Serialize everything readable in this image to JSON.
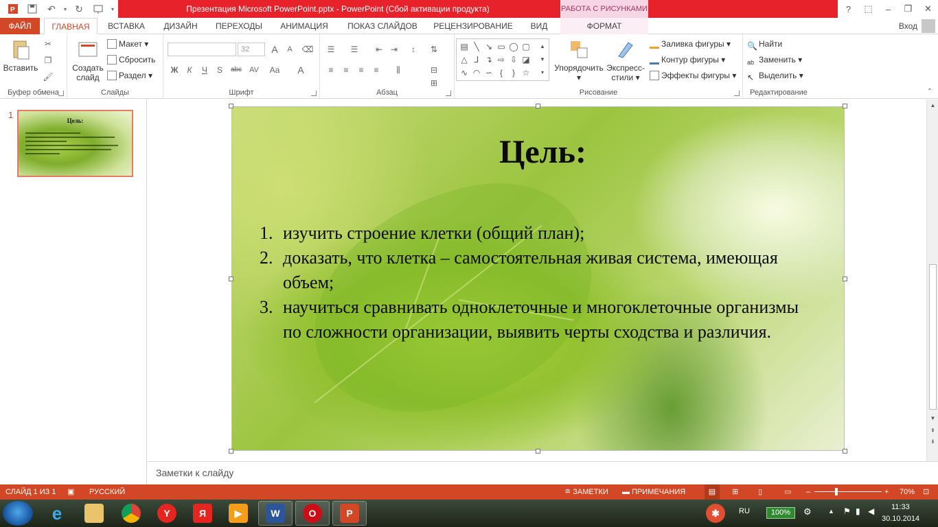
{
  "window": {
    "title": "Презентация Microsoft PowerPoint.pptx -  PowerPoint (Сбой активации продукта)",
    "context_group": "РАБОТА С РИСУНКАМИ"
  },
  "tabs": {
    "file": "ФАЙЛ",
    "home": "ГЛАВНАЯ",
    "insert": "ВСТАВКА",
    "design": "ДИЗАЙН",
    "transitions": "ПЕРЕХОДЫ",
    "animation": "АНИМАЦИЯ",
    "slideshow": "ПОКАЗ СЛАЙДОВ",
    "review": "РЕЦЕНЗИРОВАНИЕ",
    "view": "ВИД",
    "format": "ФОРМАТ",
    "login": "Вход"
  },
  "ribbon": {
    "clipboard": {
      "paste": "Вставить",
      "label": "Буфер обмена"
    },
    "slides": {
      "new_slide_line1": "Создать",
      "new_slide_line2": "слайд",
      "layout": "Макет",
      "reset": "Сбросить",
      "section": "Раздел",
      "label": "Слайды"
    },
    "font": {
      "font_size": "32",
      "bold": "Ж",
      "italic": "К",
      "underline": "Ч",
      "shadow": "S",
      "strike": "abc",
      "spacing": "AV",
      "case": "Aa",
      "color": "A",
      "grow": "A",
      "shrink": "A",
      "label": "Шрифт"
    },
    "paragraph": {
      "label": "Абзац"
    },
    "drawing": {
      "arrange": "Упорядочить",
      "quick_styles_line1": "Экспресс-",
      "quick_styles_line2": "стили",
      "fill": "Заливка фигуры",
      "outline": "Контур фигуры",
      "effects": "Эффекты фигуры",
      "label": "Рисование"
    },
    "editing": {
      "find": "Найти",
      "replace": "Заменить",
      "select": "Выделить",
      "label": "Редактирование"
    }
  },
  "thumbnails": {
    "number": "1",
    "title": "Цель:"
  },
  "slide": {
    "title": "Цель:",
    "items": [
      {
        "num": "1.",
        "text": "изучить строение клетки (общий план);"
      },
      {
        "num": "2.",
        "text": "доказать, что клетка – самостоятельная живая система, имеющая объем;"
      },
      {
        "num": "3.",
        "text": "научиться сравнивать одноклеточные и многоклеточные организмы по сложности организации, выявить черты сходства и различия."
      }
    ]
  },
  "notes": {
    "placeholder": "Заметки к слайду"
  },
  "status": {
    "slide_info": "СЛАЙД 1 ИЗ 1",
    "language": "РУССКИЙ",
    "notes": "ЗАМЕТКИ",
    "comments": "ПРИМЕЧАНИЯ",
    "zoom": "70%"
  },
  "taskbar": {
    "lang": "RU",
    "battery": "100%",
    "time": "11:33",
    "date": "30.10.2014"
  },
  "colors": {
    "accent": "#d24726",
    "titlebar": "#e8222b",
    "context_tab": "#f6d5e4"
  }
}
